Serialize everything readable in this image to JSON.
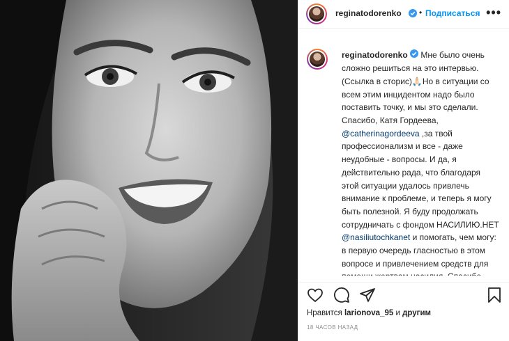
{
  "header": {
    "username": "reginatodorenko",
    "separator": "•",
    "follow_label": "Подписаться",
    "more": "•••"
  },
  "caption": {
    "username": "reginatodorenko",
    "part1": "Мне было очень сложно решиться на это интервью. (Ссылка в сторис)🙏🏻Но в ситуации со всем этим инцидентом надо было поставить точку, и мы это сделали. Спасибо, Катя Гордеева, ",
    "mention1": "@catherinagordeeva",
    "part2": " ,за твой профессионализм и все - даже неудобные - вопросы. И да, я действительно рада, что благодаря этой ситуации удалось привлечь внимание к проблеме, и теперь я могу быть полезной. Я буду продолжать сотрудничать с фондом НАСИЛИЮ.НЕТ ",
    "mention2": "@nasiliutochkanet",
    "part3": " и помогать, чем могу: в первую очередь гласностью в этом вопросе и привлечением средств для помощи жертвам насилия. Спасибо всем, кто помогал мне эти дни – без"
  },
  "likes": {
    "prefix": "Нравится ",
    "user": "larionova_95",
    "middle": " и ",
    "others": "другим"
  },
  "timestamp": "18 ЧАСОВ НАЗАД",
  "colors": {
    "accent": "#0095f6",
    "verified": "#3897f0",
    "mention": "#00376b"
  },
  "icons": [
    "verified-icon",
    "heart-icon",
    "comment-icon",
    "share-icon",
    "bookmark-icon"
  ]
}
